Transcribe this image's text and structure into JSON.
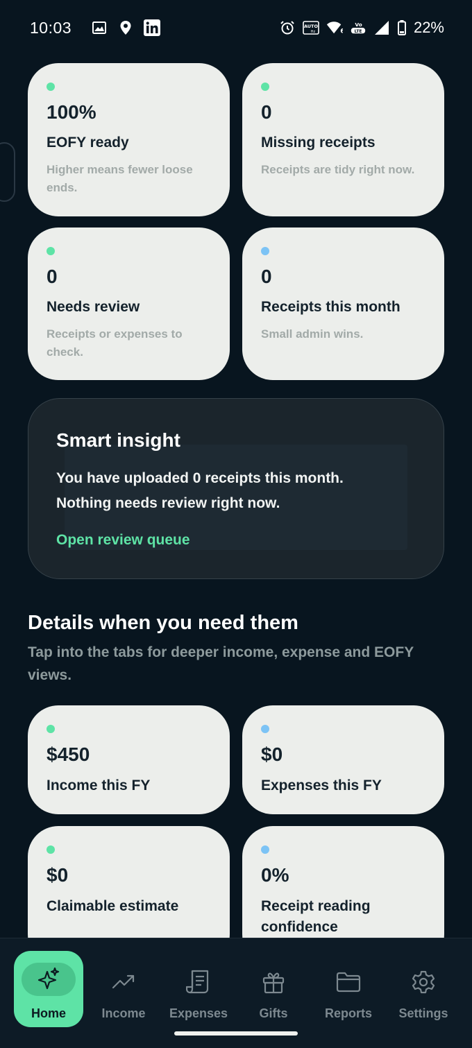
{
  "status_bar": {
    "time": "10:03",
    "battery": "22%",
    "left_icons": [
      "image-icon",
      "location-icon",
      "linkedin-icon"
    ],
    "right_icons": [
      "alarm-icon",
      "auto-hz-icon",
      "wifi-6-icon",
      "volte-icon",
      "signal-icon",
      "battery-icon"
    ]
  },
  "colors": {
    "background": "#08151f",
    "card": "#eceeeb",
    "green_dot": "#5ee3a6",
    "blue_dot": "#7cc3f5",
    "accent": "#5ee3a6"
  },
  "top_cards": [
    {
      "value": "100%",
      "label": "EOFY ready",
      "sub": "Higher means fewer loose ends.",
      "dot": "green"
    },
    {
      "value": "0",
      "label": "Missing receipts",
      "sub": "Receipts are tidy right now.",
      "dot": "green"
    },
    {
      "value": "0",
      "label": "Needs review",
      "sub": "Receipts or expenses to check.",
      "dot": "green"
    },
    {
      "value": "0",
      "label": "Receipts this month",
      "sub": "Small admin wins.",
      "dot": "blue"
    }
  ],
  "insight": {
    "title": "Smart insight",
    "line1": "You have uploaded 0 receipts this month.",
    "line2": "Nothing needs review right now.",
    "link": "Open review queue"
  },
  "details": {
    "title": "Details when you need them",
    "subtitle": "Tap into the tabs for deeper income, expense and EOFY views."
  },
  "detail_cards": [
    {
      "value": "$450",
      "label": "Income this FY",
      "dot": "green"
    },
    {
      "value": "$0",
      "label": "Expenses this FY",
      "dot": "blue"
    },
    {
      "value": "$0",
      "label": "Claimable estimate",
      "dot": "green"
    },
    {
      "value": "0%",
      "label": "Receipt reading confidence",
      "dot": "blue"
    }
  ],
  "nav": [
    {
      "label": "Home",
      "icon": "sparkles-icon",
      "active": true
    },
    {
      "label": "Income",
      "icon": "trending-up-icon",
      "active": false
    },
    {
      "label": "Expenses",
      "icon": "receipt-icon",
      "active": false
    },
    {
      "label": "Gifts",
      "icon": "gift-icon",
      "active": false
    },
    {
      "label": "Reports",
      "icon": "folder-icon",
      "active": false
    },
    {
      "label": "Settings",
      "icon": "gear-icon",
      "active": false
    }
  ]
}
